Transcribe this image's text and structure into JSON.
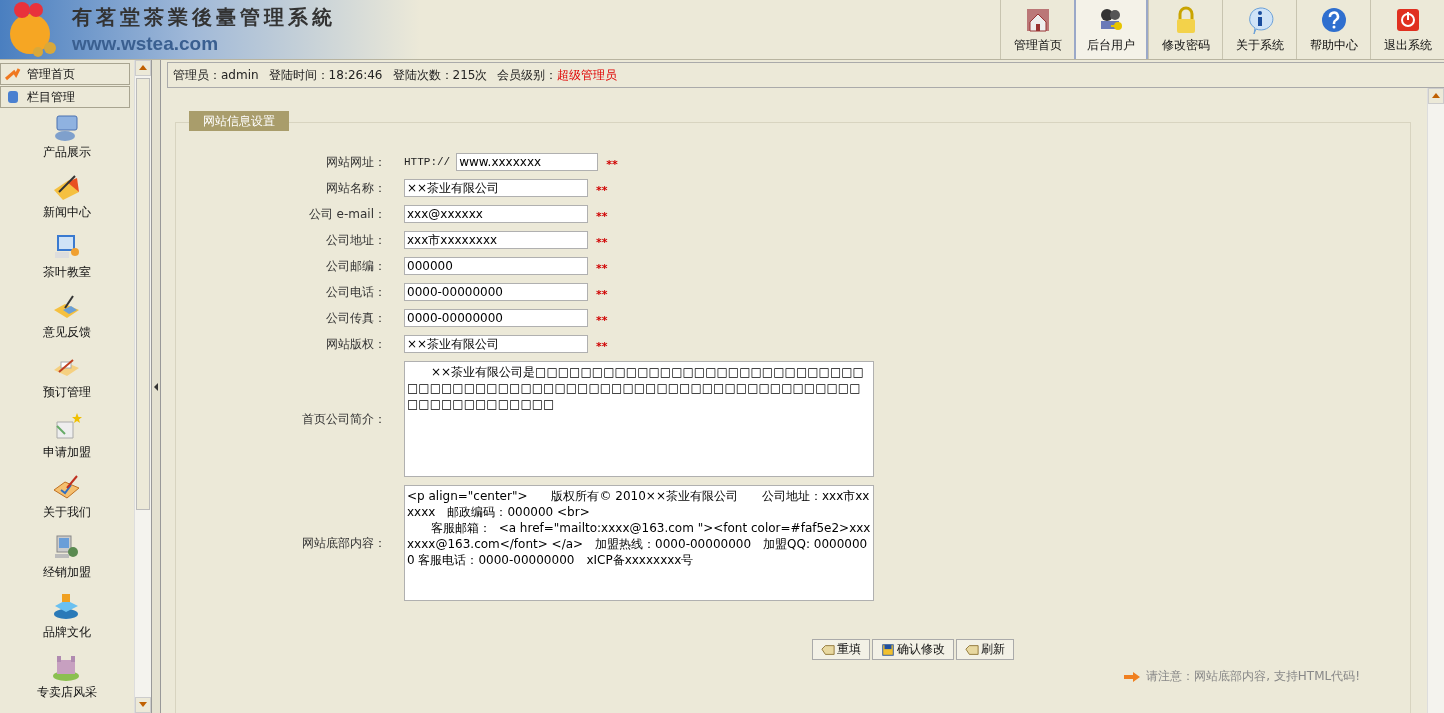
{
  "header": {
    "title": "有茗堂茶業後臺管理系統",
    "url": "www.wstea.com"
  },
  "toolbar": [
    {
      "label": "管理首页",
      "selected": false
    },
    {
      "label": "后台用户",
      "selected": true
    },
    {
      "label": "修改密码",
      "selected": false
    },
    {
      "label": "关于系统",
      "selected": false
    },
    {
      "label": "帮助中心",
      "selected": false
    },
    {
      "label": "退出系统",
      "selected": false
    }
  ],
  "sidebar": {
    "tabs": [
      {
        "label": "管理首页"
      },
      {
        "label": "栏目管理"
      }
    ],
    "items": [
      {
        "label": "产品展示"
      },
      {
        "label": "新闻中心"
      },
      {
        "label": "茶叶教室"
      },
      {
        "label": "意见反馈"
      },
      {
        "label": "预订管理"
      },
      {
        "label": "申请加盟"
      },
      {
        "label": "关于我们"
      },
      {
        "label": "经销加盟"
      },
      {
        "label": "品牌文化"
      },
      {
        "label": "专卖店风采"
      }
    ]
  },
  "status_bar": {
    "items": [
      "管理员：admin",
      "登陆时间：18:26:46",
      "登陆次数：215次"
    ],
    "level_label": "会员级别：",
    "level_value": "超级管理员"
  },
  "form": {
    "legend": "网站信息设置",
    "fields": [
      {
        "kind": "input",
        "label": "网站网址：",
        "prefix": "HTTP://",
        "value": "www.xxxxxxx",
        "required_mark": "**"
      },
      {
        "kind": "input",
        "label": "网站名称：",
        "value": "××茶业有限公司",
        "required_mark": "**"
      },
      {
        "kind": "input",
        "label": "公司 e-mail：",
        "value": "xxx@xxxxxx",
        "required_mark": "**"
      },
      {
        "kind": "input",
        "label": "公司地址：",
        "value": "xxx市xxxxxxxx",
        "required_mark": "**"
      },
      {
        "kind": "input",
        "label": "公司邮编：",
        "value": "000000",
        "required_mark": "**"
      },
      {
        "kind": "input",
        "label": "公司电话：",
        "value": "0000-00000000",
        "required_mark": "**"
      },
      {
        "kind": "input",
        "label": "公司传真：",
        "value": "0000-00000000",
        "required_mark": "**"
      },
      {
        "kind": "input",
        "label": "网站版权：",
        "value": "××茶业有限公司",
        "required_mark": "**"
      },
      {
        "kind": "textarea",
        "label": "首页公司简介：",
        "value": "　　××茶业有限公司是□□□□□□□□□□□□□□□□□□□□□□□□□□□□□□□□□□□□□□□□□□□□□□□□□□□□□□□□□□□□□□□□□□□□□□□□□□□□□□□□□□"
      },
      {
        "kind": "textarea",
        "label": "网站底部内容：",
        "value": "<p align=\"center\">　　版权所有© 2010××茶业有限公司　　公司地址：xxx市xxxxxx　邮政编码：000000 <br>\n　　客服邮箱：  <a href=\"mailto:xxxx@163.com \"><font color=#faf5e2>xxxxxxx@163.com</font> </a>　加盟热线：0000-00000000　加盟QQ: 00000000 客服电话：0000-00000000　xICP备xxxxxxxx号"
      }
    ],
    "buttons": [
      {
        "label": "重填"
      },
      {
        "label": "确认修改"
      },
      {
        "label": "刷新"
      }
    ],
    "note": "请注意：网站底部内容, 支持HTML代码!"
  }
}
